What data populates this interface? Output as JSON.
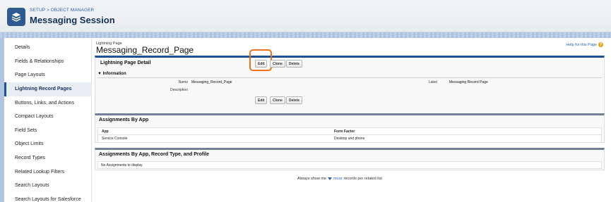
{
  "header": {
    "breadcrumb": "SETUP > OBJECT MANAGER",
    "title": "Messaging Session",
    "icon": "layers-icon"
  },
  "sidebar": {
    "items": [
      {
        "label": "Details",
        "active": false
      },
      {
        "label": "Fields & Relationships",
        "active": false
      },
      {
        "label": "Page Layouts",
        "active": false
      },
      {
        "label": "Lightning Record Pages",
        "active": true
      },
      {
        "label": "Buttons, Links, and Actions",
        "active": false
      },
      {
        "label": "Compact Layouts",
        "active": false
      },
      {
        "label": "Field Sets",
        "active": false
      },
      {
        "label": "Object Limits",
        "active": false
      },
      {
        "label": "Record Types",
        "active": false
      },
      {
        "label": "Related Lookup Filters",
        "active": false
      },
      {
        "label": "Search Layouts",
        "active": false
      },
      {
        "label": "Search Layouts for Salesforce",
        "active": false
      }
    ]
  },
  "main": {
    "page_type": "Lightning Page",
    "page_title": "Messaging_Record_Page",
    "help_link": "Help for this Page",
    "detail": {
      "title": "Lightning Page Detail",
      "buttons": {
        "edit": "Edit",
        "clone": "Clone",
        "delete": "Delete"
      },
      "section": "Information",
      "fields": {
        "name_label": "Name",
        "name_value": "Messaging_Record_Page",
        "label_label": "Label",
        "label_value": "Messaging Record Page",
        "description_label": "Description"
      }
    },
    "assignments_by_app": {
      "title": "Assignments By App",
      "columns": [
        "App",
        "Form Factor"
      ],
      "rows": [
        [
          "Service Console",
          "Desktop and phone"
        ]
      ]
    },
    "assignments_by_profile": {
      "title": "Assignments By App, Record Type, and Profile",
      "empty": "No Assignments to display"
    },
    "footer": {
      "prefix": "Always show me",
      "link": "more",
      "suffix": "records per related list"
    }
  },
  "colors": {
    "accent": "#1b5297",
    "highlight": "#ee7219",
    "link": "#2b63b6"
  }
}
